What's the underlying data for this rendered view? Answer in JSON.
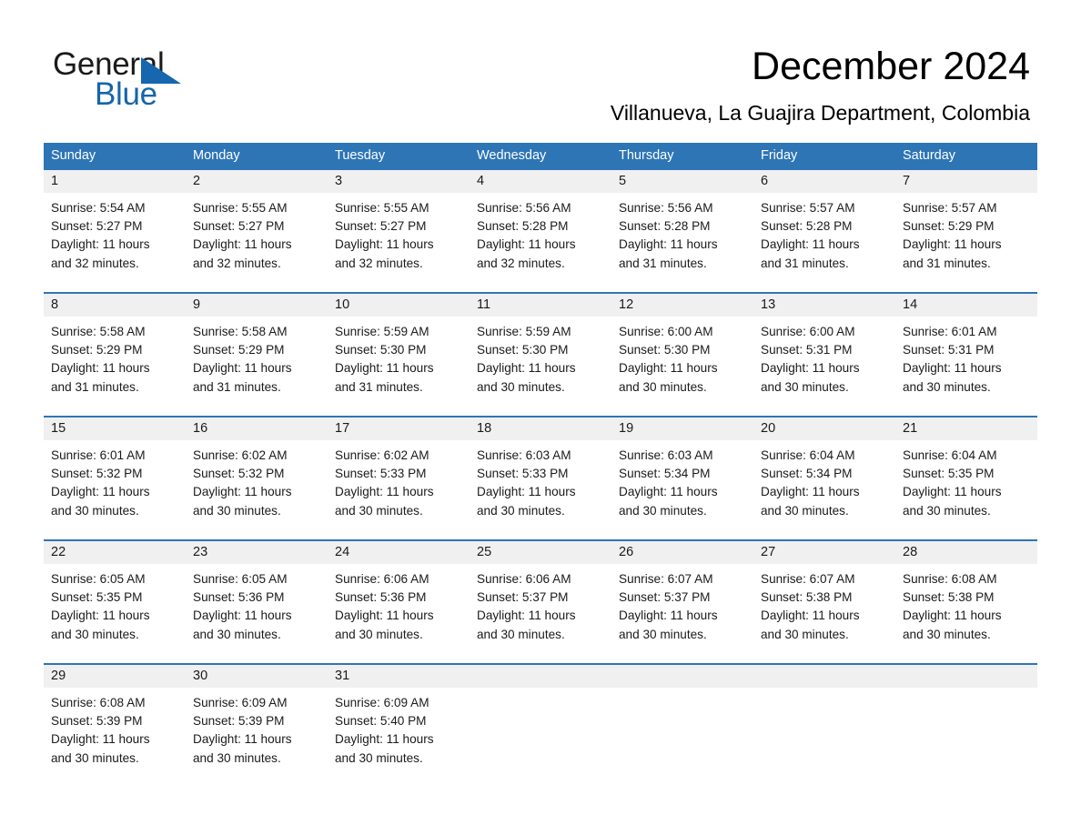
{
  "brand": {
    "name_part1": "General",
    "name_part2": "Blue",
    "triangle_color": "#1667ad",
    "blue_text_color": "#1565ab"
  },
  "header": {
    "title": "December 2024",
    "subtitle": "Villanueva, La Guajira Department, Colombia"
  },
  "theme": {
    "header_band_color": "#2e75b6",
    "day_band_color": "#f0f0f0",
    "row_rule_color": "#2e75b6",
    "text_color": "#1a1a1a"
  },
  "day_headers": [
    "Sunday",
    "Monday",
    "Tuesday",
    "Wednesday",
    "Thursday",
    "Friday",
    "Saturday"
  ],
  "weeks": [
    [
      {
        "day": "1",
        "sunrise": "Sunrise: 5:54 AM",
        "sunset": "Sunset: 5:27 PM",
        "daylight1": "Daylight: 11 hours",
        "daylight2": "and 32 minutes."
      },
      {
        "day": "2",
        "sunrise": "Sunrise: 5:55 AM",
        "sunset": "Sunset: 5:27 PM",
        "daylight1": "Daylight: 11 hours",
        "daylight2": "and 32 minutes."
      },
      {
        "day": "3",
        "sunrise": "Sunrise: 5:55 AM",
        "sunset": "Sunset: 5:27 PM",
        "daylight1": "Daylight: 11 hours",
        "daylight2": "and 32 minutes."
      },
      {
        "day": "4",
        "sunrise": "Sunrise: 5:56 AM",
        "sunset": "Sunset: 5:28 PM",
        "daylight1": "Daylight: 11 hours",
        "daylight2": "and 32 minutes."
      },
      {
        "day": "5",
        "sunrise": "Sunrise: 5:56 AM",
        "sunset": "Sunset: 5:28 PM",
        "daylight1": "Daylight: 11 hours",
        "daylight2": "and 31 minutes."
      },
      {
        "day": "6",
        "sunrise": "Sunrise: 5:57 AM",
        "sunset": "Sunset: 5:28 PM",
        "daylight1": "Daylight: 11 hours",
        "daylight2": "and 31 minutes."
      },
      {
        "day": "7",
        "sunrise": "Sunrise: 5:57 AM",
        "sunset": "Sunset: 5:29 PM",
        "daylight1": "Daylight: 11 hours",
        "daylight2": "and 31 minutes."
      }
    ],
    [
      {
        "day": "8",
        "sunrise": "Sunrise: 5:58 AM",
        "sunset": "Sunset: 5:29 PM",
        "daylight1": "Daylight: 11 hours",
        "daylight2": "and 31 minutes."
      },
      {
        "day": "9",
        "sunrise": "Sunrise: 5:58 AM",
        "sunset": "Sunset: 5:29 PM",
        "daylight1": "Daylight: 11 hours",
        "daylight2": "and 31 minutes."
      },
      {
        "day": "10",
        "sunrise": "Sunrise: 5:59 AM",
        "sunset": "Sunset: 5:30 PM",
        "daylight1": "Daylight: 11 hours",
        "daylight2": "and 31 minutes."
      },
      {
        "day": "11",
        "sunrise": "Sunrise: 5:59 AM",
        "sunset": "Sunset: 5:30 PM",
        "daylight1": "Daylight: 11 hours",
        "daylight2": "and 30 minutes."
      },
      {
        "day": "12",
        "sunrise": "Sunrise: 6:00 AM",
        "sunset": "Sunset: 5:30 PM",
        "daylight1": "Daylight: 11 hours",
        "daylight2": "and 30 minutes."
      },
      {
        "day": "13",
        "sunrise": "Sunrise: 6:00 AM",
        "sunset": "Sunset: 5:31 PM",
        "daylight1": "Daylight: 11 hours",
        "daylight2": "and 30 minutes."
      },
      {
        "day": "14",
        "sunrise": "Sunrise: 6:01 AM",
        "sunset": "Sunset: 5:31 PM",
        "daylight1": "Daylight: 11 hours",
        "daylight2": "and 30 minutes."
      }
    ],
    [
      {
        "day": "15",
        "sunrise": "Sunrise: 6:01 AM",
        "sunset": "Sunset: 5:32 PM",
        "daylight1": "Daylight: 11 hours",
        "daylight2": "and 30 minutes."
      },
      {
        "day": "16",
        "sunrise": "Sunrise: 6:02 AM",
        "sunset": "Sunset: 5:32 PM",
        "daylight1": "Daylight: 11 hours",
        "daylight2": "and 30 minutes."
      },
      {
        "day": "17",
        "sunrise": "Sunrise: 6:02 AM",
        "sunset": "Sunset: 5:33 PM",
        "daylight1": "Daylight: 11 hours",
        "daylight2": "and 30 minutes."
      },
      {
        "day": "18",
        "sunrise": "Sunrise: 6:03 AM",
        "sunset": "Sunset: 5:33 PM",
        "daylight1": "Daylight: 11 hours",
        "daylight2": "and 30 minutes."
      },
      {
        "day": "19",
        "sunrise": "Sunrise: 6:03 AM",
        "sunset": "Sunset: 5:34 PM",
        "daylight1": "Daylight: 11 hours",
        "daylight2": "and 30 minutes."
      },
      {
        "day": "20",
        "sunrise": "Sunrise: 6:04 AM",
        "sunset": "Sunset: 5:34 PM",
        "daylight1": "Daylight: 11 hours",
        "daylight2": "and 30 minutes."
      },
      {
        "day": "21",
        "sunrise": "Sunrise: 6:04 AM",
        "sunset": "Sunset: 5:35 PM",
        "daylight1": "Daylight: 11 hours",
        "daylight2": "and 30 minutes."
      }
    ],
    [
      {
        "day": "22",
        "sunrise": "Sunrise: 6:05 AM",
        "sunset": "Sunset: 5:35 PM",
        "daylight1": "Daylight: 11 hours",
        "daylight2": "and 30 minutes."
      },
      {
        "day": "23",
        "sunrise": "Sunrise: 6:05 AM",
        "sunset": "Sunset: 5:36 PM",
        "daylight1": "Daylight: 11 hours",
        "daylight2": "and 30 minutes."
      },
      {
        "day": "24",
        "sunrise": "Sunrise: 6:06 AM",
        "sunset": "Sunset: 5:36 PM",
        "daylight1": "Daylight: 11 hours",
        "daylight2": "and 30 minutes."
      },
      {
        "day": "25",
        "sunrise": "Sunrise: 6:06 AM",
        "sunset": "Sunset: 5:37 PM",
        "daylight1": "Daylight: 11 hours",
        "daylight2": "and 30 minutes."
      },
      {
        "day": "26",
        "sunrise": "Sunrise: 6:07 AM",
        "sunset": "Sunset: 5:37 PM",
        "daylight1": "Daylight: 11 hours",
        "daylight2": "and 30 minutes."
      },
      {
        "day": "27",
        "sunrise": "Sunrise: 6:07 AM",
        "sunset": "Sunset: 5:38 PM",
        "daylight1": "Daylight: 11 hours",
        "daylight2": "and 30 minutes."
      },
      {
        "day": "28",
        "sunrise": "Sunrise: 6:08 AM",
        "sunset": "Sunset: 5:38 PM",
        "daylight1": "Daylight: 11 hours",
        "daylight2": "and 30 minutes."
      }
    ],
    [
      {
        "day": "29",
        "sunrise": "Sunrise: 6:08 AM",
        "sunset": "Sunset: 5:39 PM",
        "daylight1": "Daylight: 11 hours",
        "daylight2": "and 30 minutes."
      },
      {
        "day": "30",
        "sunrise": "Sunrise: 6:09 AM",
        "sunset": "Sunset: 5:39 PM",
        "daylight1": "Daylight: 11 hours",
        "daylight2": "and 30 minutes."
      },
      {
        "day": "31",
        "sunrise": "Sunrise: 6:09 AM",
        "sunset": "Sunset: 5:40 PM",
        "daylight1": "Daylight: 11 hours",
        "daylight2": "and 30 minutes."
      },
      {
        "day": "",
        "sunrise": "",
        "sunset": "",
        "daylight1": "",
        "daylight2": ""
      },
      {
        "day": "",
        "sunrise": "",
        "sunset": "",
        "daylight1": "",
        "daylight2": ""
      },
      {
        "day": "",
        "sunrise": "",
        "sunset": "",
        "daylight1": "",
        "daylight2": ""
      },
      {
        "day": "",
        "sunrise": "",
        "sunset": "",
        "daylight1": "",
        "daylight2": ""
      }
    ]
  ]
}
